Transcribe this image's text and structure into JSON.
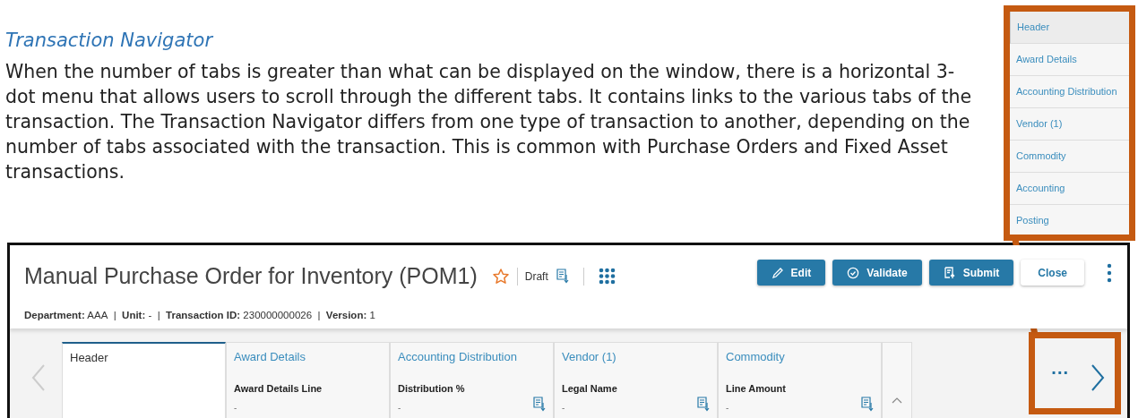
{
  "document": {
    "heading": "Transaction Navigator",
    "paragraph": "When the number of tabs is greater than what can be displayed on the window, there is a horizontal 3-dot menu that allows users to scroll through the different tabs. It contains links to the various tabs of the transaction. The Transaction Navigator differs from one type of transaction to another, depending on the number of tabs associated with the transaction. This is common with Purchase Orders and Fixed Asset transactions."
  },
  "navigator_menu": {
    "items": [
      {
        "label": "Header",
        "selected": true
      },
      {
        "label": "Award Details",
        "selected": false
      },
      {
        "label": "Accounting Distribution",
        "selected": false
      },
      {
        "label": "Vendor (1)",
        "selected": false
      },
      {
        "label": "Commodity",
        "selected": false
      },
      {
        "label": "Accounting",
        "selected": false
      },
      {
        "label": "Posting",
        "selected": false
      }
    ]
  },
  "screenshot": {
    "title": "Manual Purchase Order for Inventory (POM1)",
    "status": "Draft",
    "buttons": [
      {
        "label": "Edit",
        "kind": "edit"
      },
      {
        "label": "Validate",
        "kind": "validate"
      },
      {
        "label": "Submit",
        "kind": "submit"
      },
      {
        "label": "Close",
        "kind": "close"
      }
    ],
    "meta": [
      {
        "label": "Department:",
        "value": "AAA"
      },
      {
        "label": "Unit:",
        "value": "-"
      },
      {
        "label": "Transaction ID:",
        "value": "230000000026"
      },
      {
        "label": "Version:",
        "value": "1"
      }
    ],
    "meta_separator": "|",
    "tabs": [
      {
        "label": "Header",
        "selected": true
      },
      {
        "label": "Award Details",
        "selected": false,
        "field_label": "Award Details Line",
        "field_value": "-",
        "doc_icon": false
      },
      {
        "label": "Accounting Distribution",
        "selected": false,
        "field_label": "Distribution %",
        "field_value": "-",
        "doc_icon": true
      },
      {
        "label": "Vendor (1)",
        "selected": false,
        "field_label": "Legal Name",
        "field_value": "-",
        "doc_icon": true
      },
      {
        "label": "Commodity",
        "selected": false,
        "field_label": "Line Amount",
        "field_value": "-",
        "doc_icon": true
      }
    ],
    "more_tabs": "..."
  }
}
